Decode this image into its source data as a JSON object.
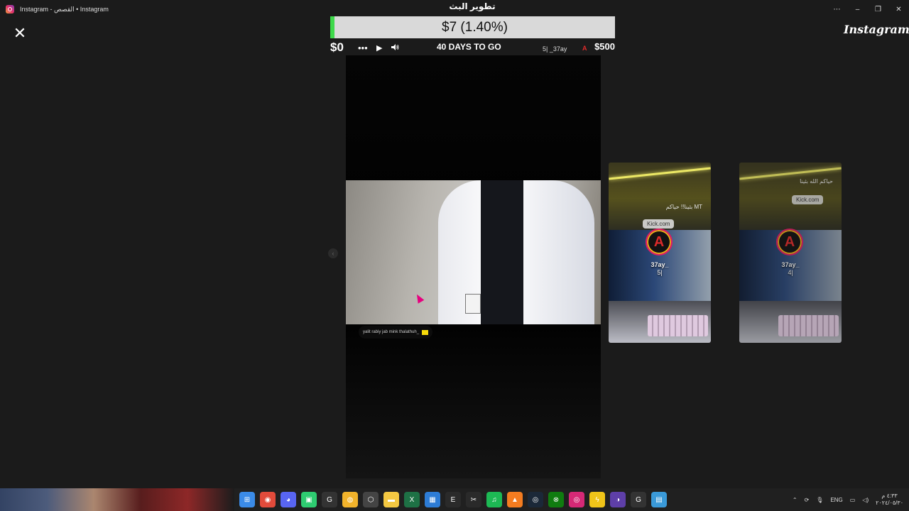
{
  "window": {
    "title": "Instagram - القصص • Instagram",
    "controls": [
      "⋯",
      "–",
      "❐",
      "✕"
    ]
  },
  "stream_overlay": {
    "title": "تطوير البث",
    "goal_progress_text": "$7 (1.40%)",
    "goal_progress_fraction": 0.014,
    "goal_start": "$0",
    "goal_end": "$500",
    "days_left": "40 DAYS TO GO",
    "donor": "5| _37ay",
    "donor_icon": "kick-logo-icon",
    "accent_green": "#3dd94a"
  },
  "instagram": {
    "logo": "Instagram",
    "close_icon": "close-icon",
    "playback": {
      "more_label": "•••",
      "play_label": "▶",
      "volume_icon": "volume-icon"
    },
    "main_story": {
      "caption": "yalit rabiy jab mink thalathuh_"
    },
    "previews": [
      {
        "username": "37ay_",
        "time_ago": "5|",
        "overlay_text": "بثينا!! حياكم MT",
        "link_label": "Kick.com",
        "avatar_letter": "A"
      },
      {
        "username": "37ay_",
        "time_ago": "4|",
        "overlay_text": "حياكم الله بثينا",
        "link_label": "Kick.com",
        "avatar_letter": "A"
      }
    ],
    "prev_arrow": "‹"
  },
  "taskbar": {
    "icons": [
      {
        "name": "start-icon",
        "glyph": "⊞",
        "color": "#3b8be8"
      },
      {
        "name": "chrome-icon",
        "glyph": "◉",
        "color": "#e24b3b"
      },
      {
        "name": "discord-icon",
        "glyph": "◕",
        "color": "#5865f2"
      },
      {
        "name": "app-green-icon",
        "glyph": "▣",
        "color": "#2ecc71"
      },
      {
        "name": "app-g-icon",
        "glyph": "G",
        "color": "#333333"
      },
      {
        "name": "app-yellow-icon",
        "glyph": "◍",
        "color": "#f2b32b"
      },
      {
        "name": "app-hex-icon",
        "glyph": "⬡",
        "color": "#444444"
      },
      {
        "name": "folder-icon",
        "glyph": "▬",
        "color": "#f4c842"
      },
      {
        "name": "excel-icon",
        "glyph": "X",
        "color": "#1e7145"
      },
      {
        "name": "store-icon",
        "glyph": "▦",
        "color": "#2d7cd6"
      },
      {
        "name": "epic-icon",
        "glyph": "E",
        "color": "#2a2a2a"
      },
      {
        "name": "capcut-icon",
        "glyph": "✂",
        "color": "#2a2a2a"
      },
      {
        "name": "spotify-icon",
        "glyph": "♫",
        "color": "#1db954"
      },
      {
        "name": "app-orange-icon",
        "glyph": "▲",
        "color": "#f47c20"
      },
      {
        "name": "steam-icon",
        "glyph": "◎",
        "color": "#1b2838"
      },
      {
        "name": "xbox-icon",
        "glyph": "⊗",
        "color": "#107c10"
      },
      {
        "name": "instagram-taskbar-icon",
        "glyph": "◎",
        "color": "#d62976"
      },
      {
        "name": "app-lightning-icon",
        "glyph": "ϟ",
        "color": "#f0c419"
      },
      {
        "name": "app-purple-icon",
        "glyph": "◑",
        "color": "#5e3fa8"
      },
      {
        "name": "app-g2-icon",
        "glyph": "G",
        "color": "#333333"
      },
      {
        "name": "photos-icon",
        "glyph": "▤",
        "color": "#3a9ad9"
      }
    ],
    "tray": {
      "language": "ENG",
      "time": "٤:٣٣ م",
      "date": "٢٠٢٤/٠٥/٣٠"
    }
  }
}
